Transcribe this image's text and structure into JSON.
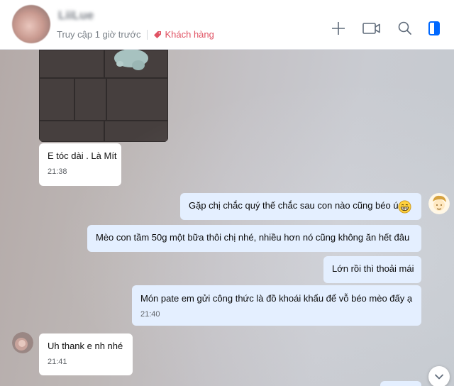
{
  "header": {
    "contact_name": "LiiLue",
    "last_seen": "Truy cập 1 giờ trước",
    "tag_label": "Khách hàng",
    "icons": [
      "add-icon",
      "video-call-icon",
      "search-icon",
      "sidebar-panel-icon"
    ],
    "colors": {
      "tag": "#e05263",
      "icon": "#5f6b7a",
      "panel_icon": "#0068ff"
    }
  },
  "messages": {
    "m1_text": "E tóc dài . Là Mít",
    "m1_time": "21:38",
    "m2_text": "Gặp chị chắc quý thế chắc sau con nào cũng béo ú",
    "m3_text": "Mèo con tầm 50g một bữa thôi chị nhé, nhiều hơn nó cũng không ăn hết đâu",
    "m4_text": "Lớn rồi thì thoải mái",
    "m5_text": "Món pate em gửi công thức là đồ khoái khẩu để vỗ béo mèo đấy ạ",
    "m5_time": "21:40",
    "m6_text": "Uh thank e nh nhé",
    "m6_time": "21:41"
  },
  "colors": {
    "bubble_in": "#ffffff",
    "bubble_out": "#e4efff"
  }
}
